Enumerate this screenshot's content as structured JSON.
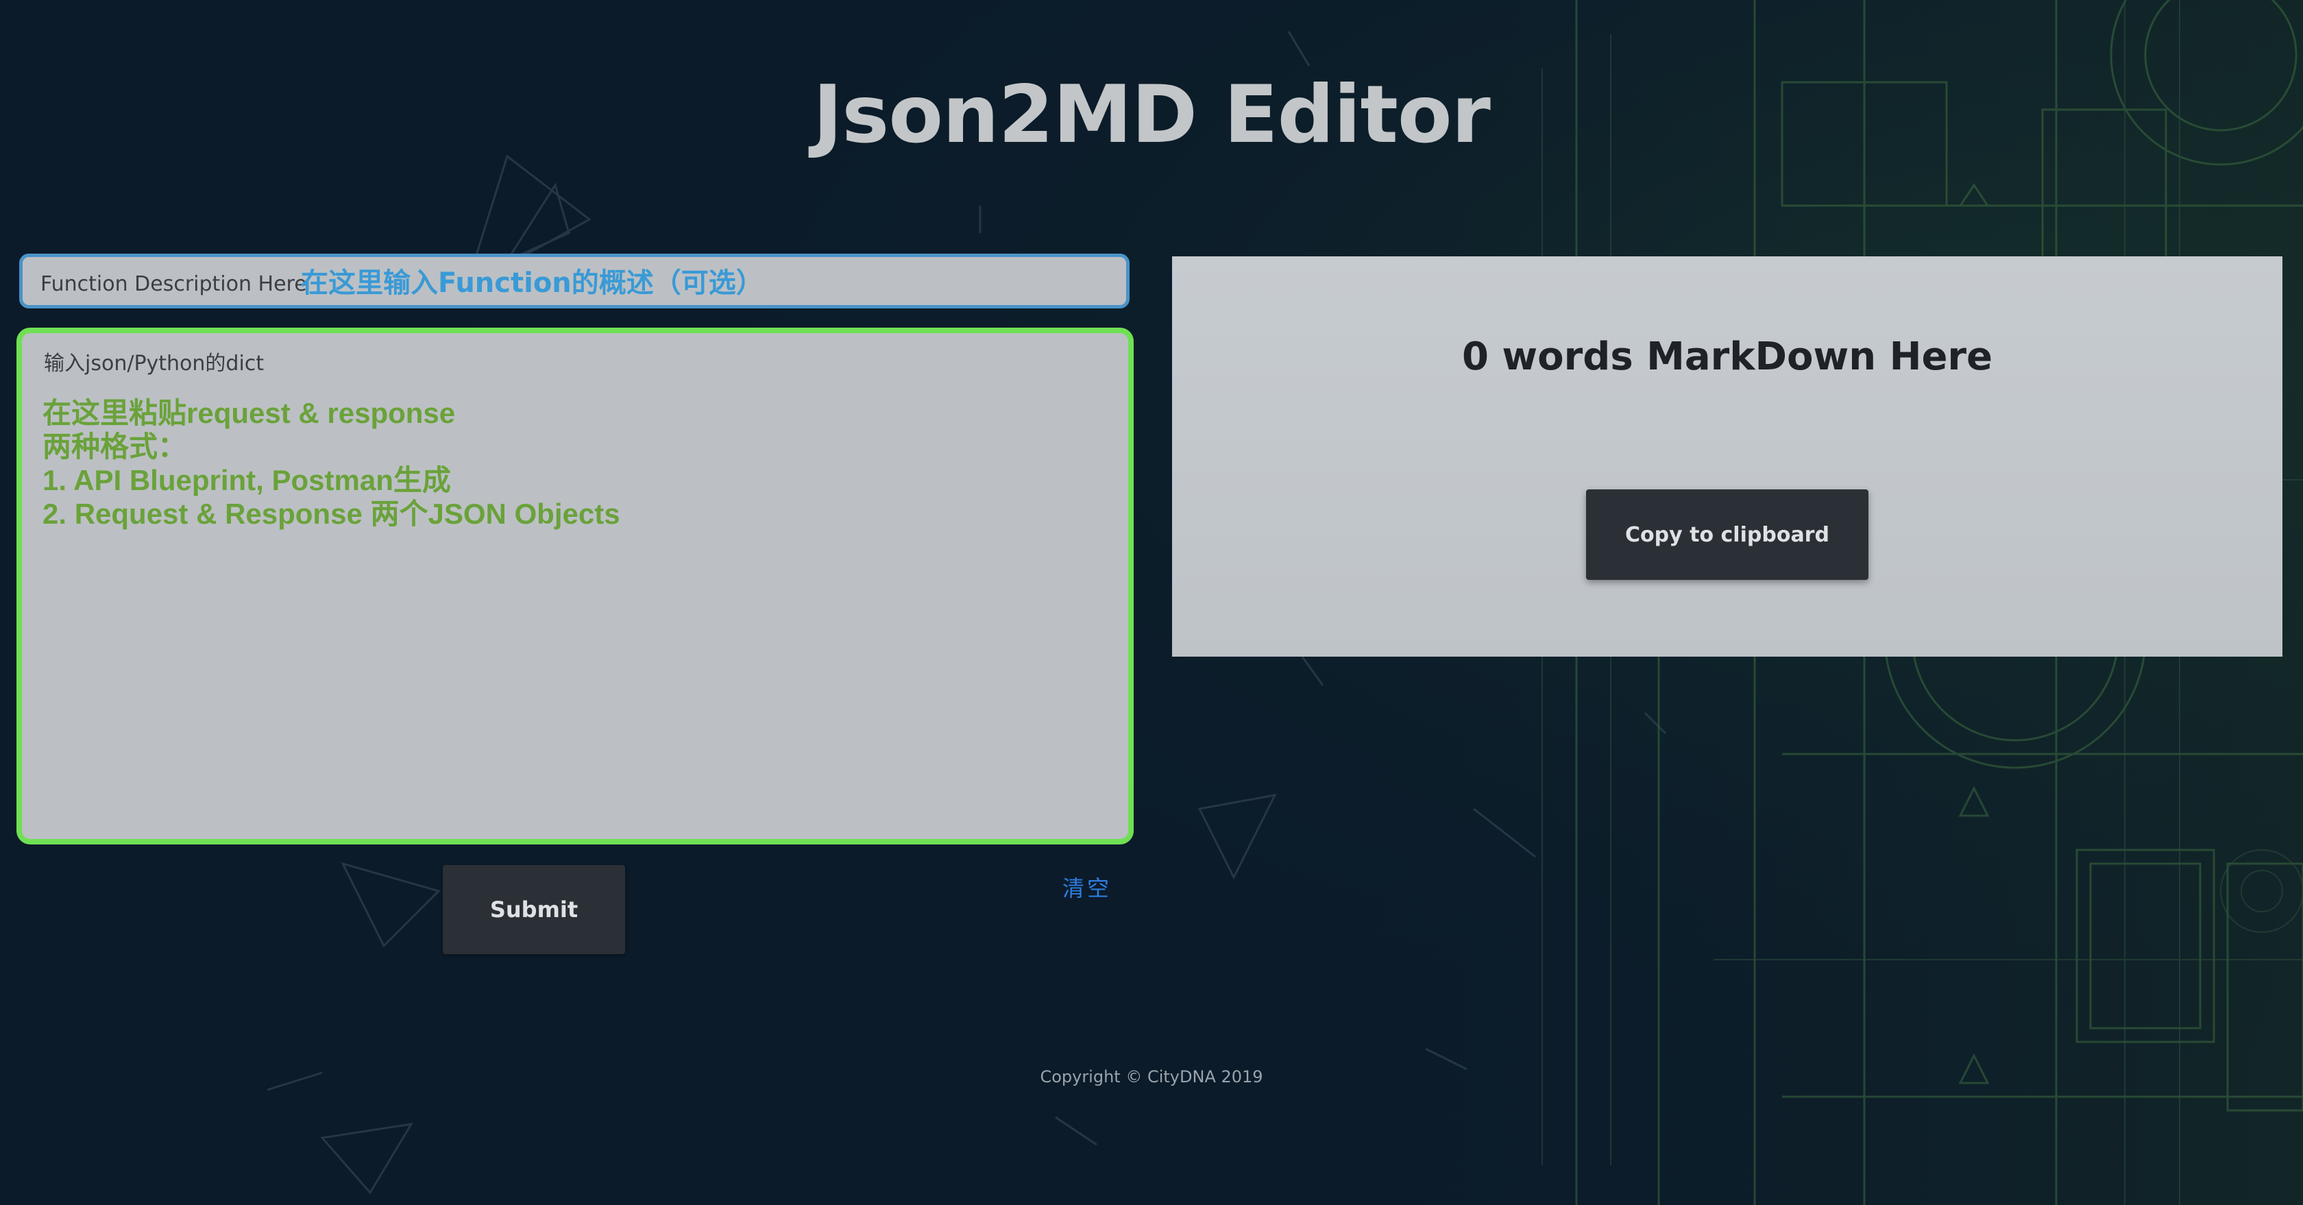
{
  "page": {
    "title": "Json2MD Editor",
    "background_color": "#0b1b2a"
  },
  "description_input": {
    "label": "Function Description Here",
    "hint": "在这里输入Function的概述（可选）"
  },
  "json_input": {
    "label": "输入json/Python的dict",
    "hints": [
      "在这里粘贴request & response",
      "两种格式：",
      "1. API Blueprint, Postman生成",
      "2. Request & Response 两个JSON Objects"
    ]
  },
  "actions": {
    "submit_label": "Submit",
    "clear_label": "清空"
  },
  "markdown_panel": {
    "heading": "0 words MarkDown Here",
    "copy_label": "Copy to clipboard"
  },
  "footer": {
    "copyright": "Copyright © CityDNA 2019"
  },
  "colors": {
    "accent_green": "#6fe054",
    "accent_blue": "#4a93c8",
    "button_dark": "#2b3037",
    "link_blue": "#2f7de0"
  }
}
